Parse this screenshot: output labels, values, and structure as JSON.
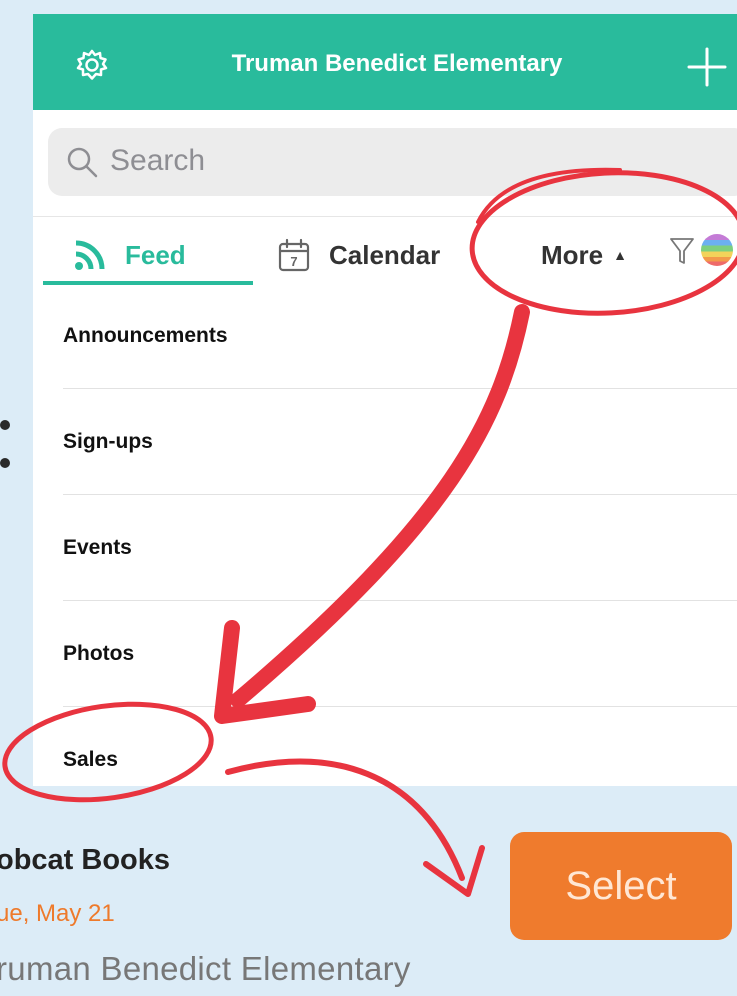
{
  "app": {
    "title": "Truman Benedict Elementary"
  },
  "search": {
    "placeholder": "Search"
  },
  "tabs": {
    "feed": "Feed",
    "calendar": "Calendar",
    "calendar_day": "7",
    "more": "More",
    "more_caret": "▲"
  },
  "menu": {
    "items": [
      "Announcements",
      "Sign-ups",
      "Events",
      "Photos",
      "Sales"
    ]
  },
  "sale_card": {
    "title": "obcat Books",
    "date": "ue, May 21",
    "org": "ruman Benedict Elementary",
    "button": "Select"
  },
  "colors": {
    "brand": "#29bb9c",
    "accent_orange": "#ef7b2d",
    "annotation_red": "#e8343f",
    "background": "#dcecf7"
  },
  "icons": [
    "gear-icon",
    "plus-icon",
    "search-icon",
    "feed-icon",
    "calendar-icon",
    "filter-icon",
    "rainbow-avatar-icon"
  ]
}
